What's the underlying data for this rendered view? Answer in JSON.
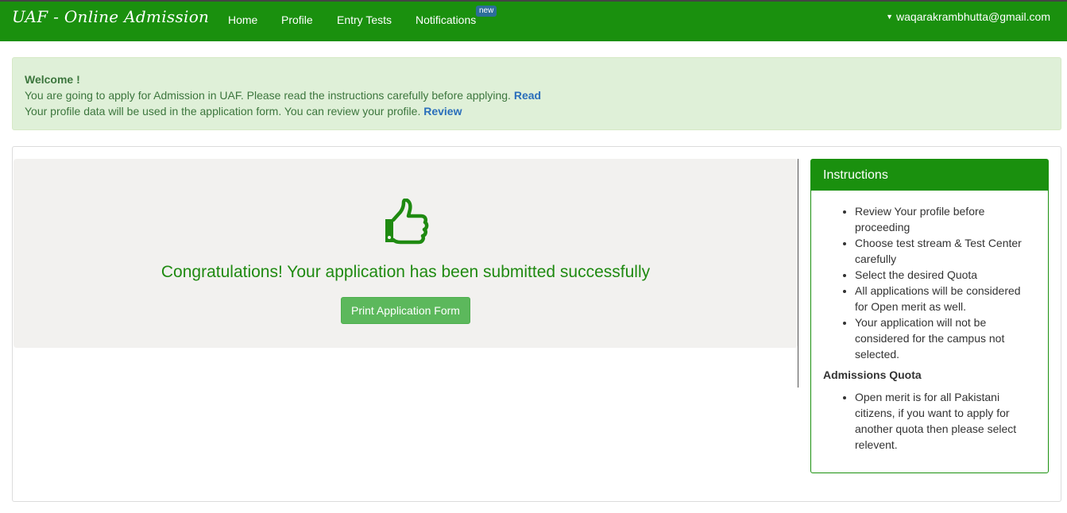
{
  "navbar": {
    "brand": "UAF - Online Admission",
    "links": [
      "Home",
      "Profile",
      "Entry Tests",
      "Notifications"
    ],
    "notification_badge": "new",
    "user_email": "waqarakrambhutta@gmail.com"
  },
  "alert": {
    "welcome": "Welcome !",
    "line1": "You are going to apply for Admission in UAF. Please read the instructions carefully before applying.",
    "line1_link": "Read",
    "line2": "Your profile data will be used in the application form. You can review your profile.",
    "line2_link": "Review"
  },
  "main": {
    "icon": "thumbs-up-icon",
    "message": "Congratulations! Your application has been submitted successfully",
    "print_button": "Print Application Form"
  },
  "instructions": {
    "title": "Instructions",
    "items": [
      "Review Your profile before proceeding",
      "Choose test stream & Test Center carefully",
      "Select the desired Quota",
      "All applications will be considered for Open merit as well.",
      "Your application will not be considered for the campus not selected."
    ],
    "quota_title": "Admissions Quota",
    "quota_items": [
      "Open merit is for all Pakistani citizens, if you want to apply for another quota then please select relevent."
    ]
  },
  "colors": {
    "brand_green": "#1a900e",
    "success_text": "#1f8a11",
    "button_green": "#5cb85c",
    "alert_bg": "#dff0d8",
    "link_blue": "#2a6ebb"
  }
}
